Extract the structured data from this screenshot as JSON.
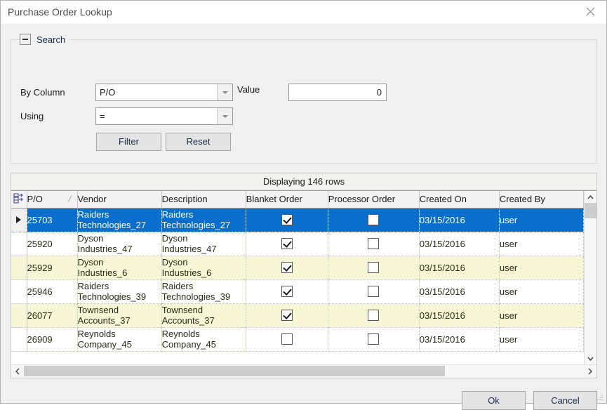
{
  "window": {
    "title": "Purchase Order Lookup",
    "close_icon": "close-icon"
  },
  "search": {
    "group_title": "Search",
    "collapse_icon": "minus-icon",
    "by_column_label": "By Column",
    "by_column_value": "P/O",
    "using_label": "Using",
    "using_value": "=",
    "value_label": "Value",
    "value_text": "0",
    "filter_label": "Filter",
    "reset_label": "Reset"
  },
  "grid": {
    "caption": "Displaying 146 rows",
    "sort_indicator": "/",
    "columns": [
      "P/O",
      "Vendor",
      "Description",
      "Blanket Order",
      "Processor Order",
      "Created On",
      "Created By"
    ],
    "rows": [
      {
        "po": "25703",
        "vendor_line1": "Raiders",
        "vendor_line2": "Technologies_27",
        "desc_line1": "Raiders",
        "desc_line2": "Technologies_27",
        "blanket_order": true,
        "processor_order": false,
        "created_on": "03/15/2016",
        "created_by": "user",
        "selected": true,
        "current": true
      },
      {
        "po": "25920",
        "vendor_line1": "Dyson",
        "vendor_line2": "Industries_47",
        "desc_line1": "Dyson",
        "desc_line2": "Industries_47",
        "blanket_order": true,
        "processor_order": false,
        "created_on": "03/15/2016",
        "created_by": "user",
        "selected": false,
        "current": false
      },
      {
        "po": "25929",
        "vendor_line1": "Dyson",
        "vendor_line2": "Industries_6",
        "desc_line1": "Dyson",
        "desc_line2": "Industries_6",
        "blanket_order": true,
        "processor_order": false,
        "created_on": "03/15/2016",
        "created_by": "user",
        "selected": false,
        "current": false
      },
      {
        "po": "25946",
        "vendor_line1": "Raiders",
        "vendor_line2": "Technologies_39",
        "desc_line1": "Raiders",
        "desc_line2": "Technologies_39",
        "blanket_order": true,
        "processor_order": false,
        "created_on": "03/15/2016",
        "created_by": "user",
        "selected": false,
        "current": false
      },
      {
        "po": "26077",
        "vendor_line1": "Townsend",
        "vendor_line2": "Accounts_37",
        "desc_line1": "Townsend",
        "desc_line2": "Accounts_37",
        "blanket_order": true,
        "processor_order": false,
        "created_on": "03/15/2016",
        "created_by": "user",
        "selected": false,
        "current": false
      },
      {
        "po": "26909",
        "vendor_line1": "Reynolds",
        "vendor_line2": "Company_45",
        "desc_line1": "Reynolds",
        "desc_line2": "Company_45",
        "blanket_order": false,
        "processor_order": false,
        "created_on": "03/15/2016",
        "created_by": "user",
        "selected": false,
        "current": false
      }
    ]
  },
  "footer": {
    "ok_label": "Ok",
    "cancel_label": "Cancel"
  },
  "colors": {
    "selection": "#0a6ecd",
    "alt_row": "#f7f7d5",
    "window_bg": "#f0f0f0"
  }
}
